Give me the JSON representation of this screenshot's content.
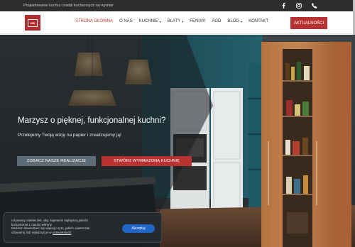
{
  "topbar": {
    "tagline": "Projektowanie kuchni i mebli kuchennych na wymiar",
    "social_icons": [
      "facebook-icon",
      "instagram-icon",
      "phone-icon"
    ]
  },
  "nav": {
    "logo_text": "NB",
    "items": [
      {
        "label": "STRONA GŁÓWNA",
        "active": true,
        "dropdown": false
      },
      {
        "label": "O NAS",
        "active": false,
        "dropdown": false
      },
      {
        "label": "KUCHNIE",
        "active": false,
        "dropdown": true
      },
      {
        "label": "BLATY",
        "active": false,
        "dropdown": true
      },
      {
        "label": "FENIX®",
        "active": false,
        "dropdown": false
      },
      {
        "label": "AGD",
        "active": false,
        "dropdown": false
      },
      {
        "label": "BLOG",
        "active": false,
        "dropdown": true
      },
      {
        "label": "KONTAKT",
        "active": false,
        "dropdown": false
      }
    ],
    "cta": "AKTUALNOŚCI",
    "caret": "▾"
  },
  "hero": {
    "title": "Marzysz o pięknej, funkcjonalnej kuchni?",
    "subtitle": "Przełejemy Twoją wizję na papier i zrealizujemy ją!",
    "btn_realizacje": "ZOBACZ NASZE REALIZACJE",
    "btn_stworz": "STWÓRZ WYMARZONĄ KUCHNIĘ"
  },
  "cookie": {
    "line1": "Używamy ciasteczek, aby zapewnić najlepszą jakość",
    "line2": "korzystania z naszej witryny.",
    "line3": "Możesz dowiedzieć się więcej o tym, jakich ciasteczek",
    "line4_prefix": "używamy, lub wyłączyć je w ",
    "link": "ustawieniach",
    "line4_suffix": ".",
    "accept": "Akceptuj"
  },
  "colors": {
    "accent_red": "#b83232",
    "topbar_bg": "#2d2d2d",
    "accept_blue": "#1f66c7"
  }
}
